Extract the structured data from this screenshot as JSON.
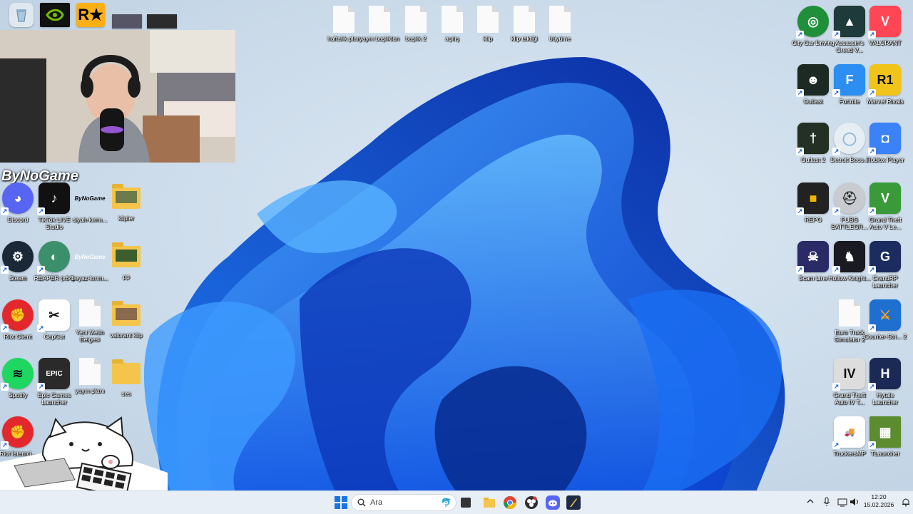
{
  "taskbar": {
    "search_placeholder": "Ara",
    "time": "12:20",
    "date": "15.02.2026"
  },
  "overlay": {
    "brand": "ByNoGame"
  },
  "top_shortcuts": [
    {
      "label": "haftalık plan"
    },
    {
      "label": "yayın başlıkları"
    },
    {
      "label": "başlık 2"
    },
    {
      "label": "açılış"
    },
    {
      "label": "klip"
    },
    {
      "label": "klip taktiği"
    },
    {
      "label": "büyüme"
    }
  ],
  "left_icons": [
    {
      "label": "Discord",
      "color": "#5865f2"
    },
    {
      "label": "TikTok LIVE Studio",
      "color": "#111111"
    },
    {
      "label": "siyah-kırmı...",
      "color": "#ffffff"
    },
    {
      "label": "klipler",
      "color": "#f4c54a"
    },
    {
      "label": "Steam",
      "color": "#1b2838"
    },
    {
      "label": "REAPER (x64)",
      "color": "#3b8f6a"
    },
    {
      "label": "beyaz-kırmı...",
      "color": "#ffffff"
    },
    {
      "label": "pp",
      "color": "#f4c54a"
    },
    {
      "label": "Riot Client",
      "color": "#e2282c"
    },
    {
      "label": "CapCut",
      "color": "#ffffff"
    },
    {
      "label": "Yeni Metin Belgesi",
      "color": "#fafafa"
    },
    {
      "label": "valorant klip",
      "color": "#f4c54a"
    },
    {
      "label": "Spotify",
      "color": "#1ed760"
    },
    {
      "label": "Epic Games Launcher",
      "color": "#2a2a2a"
    },
    {
      "label": "yayın planı",
      "color": "#fafafa"
    },
    {
      "label": "ses",
      "color": "#f4c54a"
    },
    {
      "label": "Riot İstemci...",
      "color": "#e2282c"
    }
  ],
  "right_icons": [
    {
      "label": "City Car Driving",
      "color": "#1f8f3a"
    },
    {
      "label": "Assassin's Creed V...",
      "color": "#1e3a3a"
    },
    {
      "label": "VALORANT",
      "color": "#ff4655"
    },
    {
      "label": "Outlast",
      "color": "#1d2a24"
    },
    {
      "label": "Fortnite",
      "color": "#2b8ef0"
    },
    {
      "label": "Marvel Rivals",
      "color": "#f0c419"
    },
    {
      "label": "Outlast 2",
      "color": "#243024"
    },
    {
      "label": "Detroit Beco...",
      "color": "#e6eef4"
    },
    {
      "label": "Roblox Player",
      "color": "#3b82f6"
    },
    {
      "label": "REPO",
      "color": "#222222"
    },
    {
      "label": "PUBG BATTLEGR...",
      "color": "#c8ccd0"
    },
    {
      "label": "Grand Theft Auto V Le...",
      "color": "#3a9a3a"
    },
    {
      "label": "Scam Line",
      "color": "#2a2a66"
    },
    {
      "label": "Hollow Knight...",
      "color": "#1a1a22"
    },
    {
      "label": "GrandRP Launcher",
      "color": "#1c2c60"
    },
    {
      "label": "Euro Truck Simulator 2",
      "color": "#fafafa"
    },
    {
      "label": "Counter-Stri... 2",
      "color": "#1f6fd1"
    },
    {
      "label": "Grand Theft Auto IV T...",
      "color": "#dddddd"
    },
    {
      "label": "Hytale Launcher",
      "color": "#1b2a55"
    },
    {
      "label": "TruckersMP",
      "color": "#ffffff"
    },
    {
      "label": "TLauncher",
      "color": "#5b8c2f"
    }
  ],
  "top_row_icons": [
    {
      "label": "recycle-bin",
      "color": "#dfe8ef"
    },
    {
      "label": "nvidia",
      "color": "#76b900"
    },
    {
      "label": "rockstar",
      "color": "#fcaf17"
    }
  ]
}
